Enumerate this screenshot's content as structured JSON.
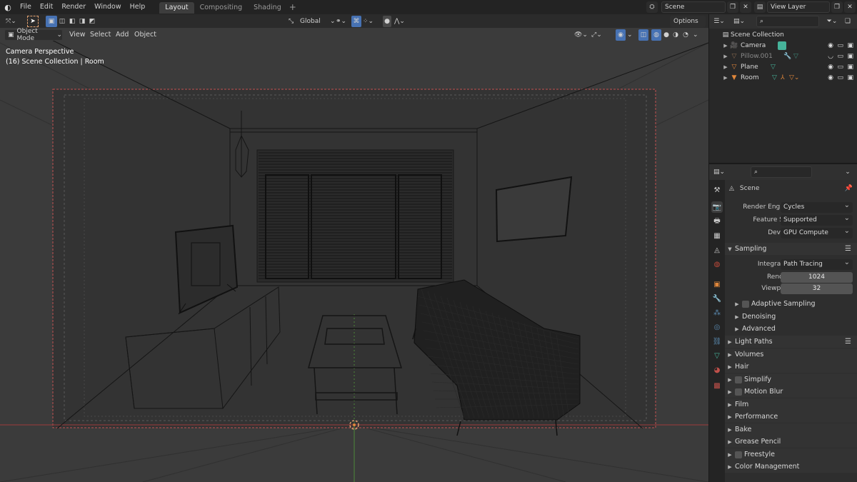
{
  "topbar": {
    "menus": [
      "File",
      "Edit",
      "Render",
      "Window",
      "Help"
    ],
    "workspace_tabs": [
      "Layout",
      "Compositing",
      "Shading"
    ],
    "active_tab": "Layout",
    "add_tab": "+",
    "scene_name": "Scene",
    "view_layer_name": "View Layer"
  },
  "viewport": {
    "transform_orientation": "Global",
    "options_label": "Options",
    "mode_label": "Object Mode",
    "menus": [
      "View",
      "Select",
      "Add",
      "Object"
    ],
    "overlay_line1": "Camera Perspective",
    "overlay_line2": "(16) Scene Collection | Room"
  },
  "outliner": {
    "root": "Scene Collection",
    "items": [
      {
        "name": "Camera",
        "dim": false
      },
      {
        "name": "Pillow.001",
        "dim": true
      },
      {
        "name": "Plane",
        "dim": false
      },
      {
        "name": "Room",
        "dim": false
      }
    ]
  },
  "properties": {
    "context_name": "Scene",
    "render_engine_label": "Render Engine",
    "render_engine_value": "Cycles",
    "feature_set_label": "Feature Set",
    "feature_set_value": "Supported",
    "device_label": "Device",
    "device_value": "GPU Compute",
    "sampling_header": "Sampling",
    "integrator_label": "Integrator",
    "integrator_value": "Path Tracing",
    "render_label": "Render",
    "render_value": "1024",
    "viewport_label": "Viewport",
    "viewport_value": "32",
    "subpanels": [
      "Adaptive Sampling",
      "Denoising",
      "Advanced"
    ],
    "panels": [
      "Light Paths",
      "Volumes",
      "Hair",
      "Simplify",
      "Motion Blur",
      "Film",
      "Performance",
      "Bake",
      "Grease Pencil",
      "Freestyle",
      "Color Management"
    ]
  },
  "colors": {
    "viewport_bg": "#3b3b3b",
    "accent_blue": "#4772b3",
    "object_orange": "#e0873b",
    "mesh_green": "#46b39a",
    "camera_frame": "#c05050"
  }
}
